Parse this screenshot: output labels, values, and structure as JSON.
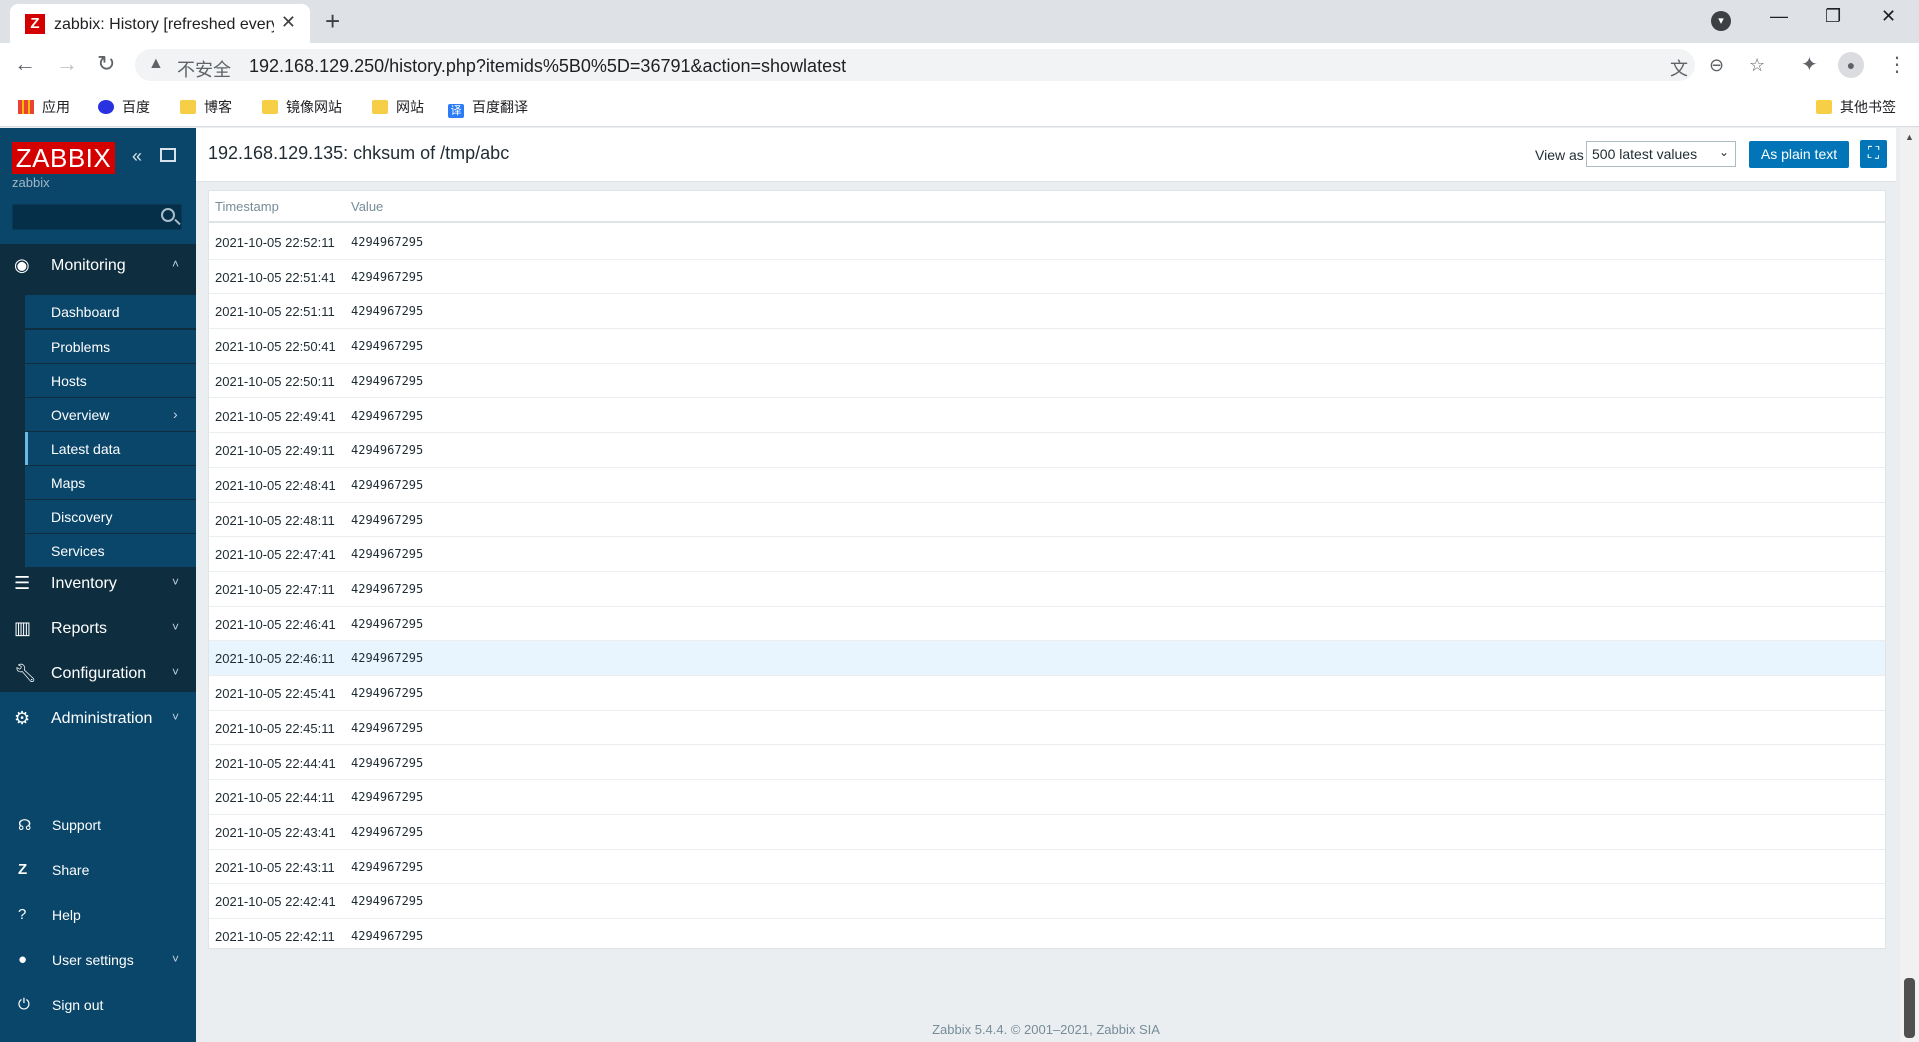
{
  "browser": {
    "tab_title": "zabbix: History [refreshed every",
    "tab_favicon": "Z",
    "insecure_label": "不安全",
    "url": "192.168.129.250/history.php?itemids%5B0%5D=36791&action=showlatest",
    "bookmarks": [
      "应用",
      "百度",
      "博客",
      "镜像网站",
      "网站",
      "百度翻译",
      "其他书签"
    ]
  },
  "sidebar": {
    "logo": "ZABBIX",
    "server_name": "zabbix",
    "search_placeholder": "",
    "monitoring": {
      "label": "Monitoring",
      "items": [
        "Dashboard",
        "Problems",
        "Hosts",
        "Overview",
        "Latest data",
        "Maps",
        "Discovery",
        "Services"
      ],
      "active": "Latest data"
    },
    "sections": [
      "Inventory",
      "Reports",
      "Configuration",
      "Administration"
    ],
    "bottom": [
      "Support",
      "Share",
      "Help",
      "User settings",
      "Sign out"
    ]
  },
  "header": {
    "title": "192.168.129.135: chksum of /tmp/abc",
    "view_as_label": "View as",
    "view_as_value": "500 latest values",
    "plain_text_button": "As plain text"
  },
  "table": {
    "columns": [
      "Timestamp",
      "Value"
    ],
    "rows": [
      {
        "ts": "2021-10-05 22:52:11",
        "value": "4294967295"
      },
      {
        "ts": "2021-10-05 22:51:41",
        "value": "4294967295"
      },
      {
        "ts": "2021-10-05 22:51:11",
        "value": "4294967295"
      },
      {
        "ts": "2021-10-05 22:50:41",
        "value": "4294967295"
      },
      {
        "ts": "2021-10-05 22:50:11",
        "value": "4294967295"
      },
      {
        "ts": "2021-10-05 22:49:41",
        "value": "4294967295"
      },
      {
        "ts": "2021-10-05 22:49:11",
        "value": "4294967295"
      },
      {
        "ts": "2021-10-05 22:48:41",
        "value": "4294967295"
      },
      {
        "ts": "2021-10-05 22:48:11",
        "value": "4294967295"
      },
      {
        "ts": "2021-10-05 22:47:41",
        "value": "4294967295"
      },
      {
        "ts": "2021-10-05 22:47:11",
        "value": "4294967295"
      },
      {
        "ts": "2021-10-05 22:46:41",
        "value": "4294967295"
      },
      {
        "ts": "2021-10-05 22:46:11",
        "value": "4294967295"
      },
      {
        "ts": "2021-10-05 22:45:41",
        "value": "4294967295"
      },
      {
        "ts": "2021-10-05 22:45:11",
        "value": "4294967295"
      },
      {
        "ts": "2021-10-05 22:44:41",
        "value": "4294967295"
      },
      {
        "ts": "2021-10-05 22:44:11",
        "value": "4294967295"
      },
      {
        "ts": "2021-10-05 22:43:41",
        "value": "4294967295"
      },
      {
        "ts": "2021-10-05 22:43:11",
        "value": "4294967295"
      },
      {
        "ts": "2021-10-05 22:42:41",
        "value": "4294967295"
      },
      {
        "ts": "2021-10-05 22:42:11",
        "value": "4294967295"
      }
    ],
    "highlighted_row": "2021-10-05 22:46:11"
  },
  "footer": "Zabbix 5.4.4. © 2001–2021, Zabbix SIA",
  "colors": {
    "sidebar_bg": "#0a466a",
    "logo_red": "#d40000",
    "button_blue": "#0275b8"
  }
}
